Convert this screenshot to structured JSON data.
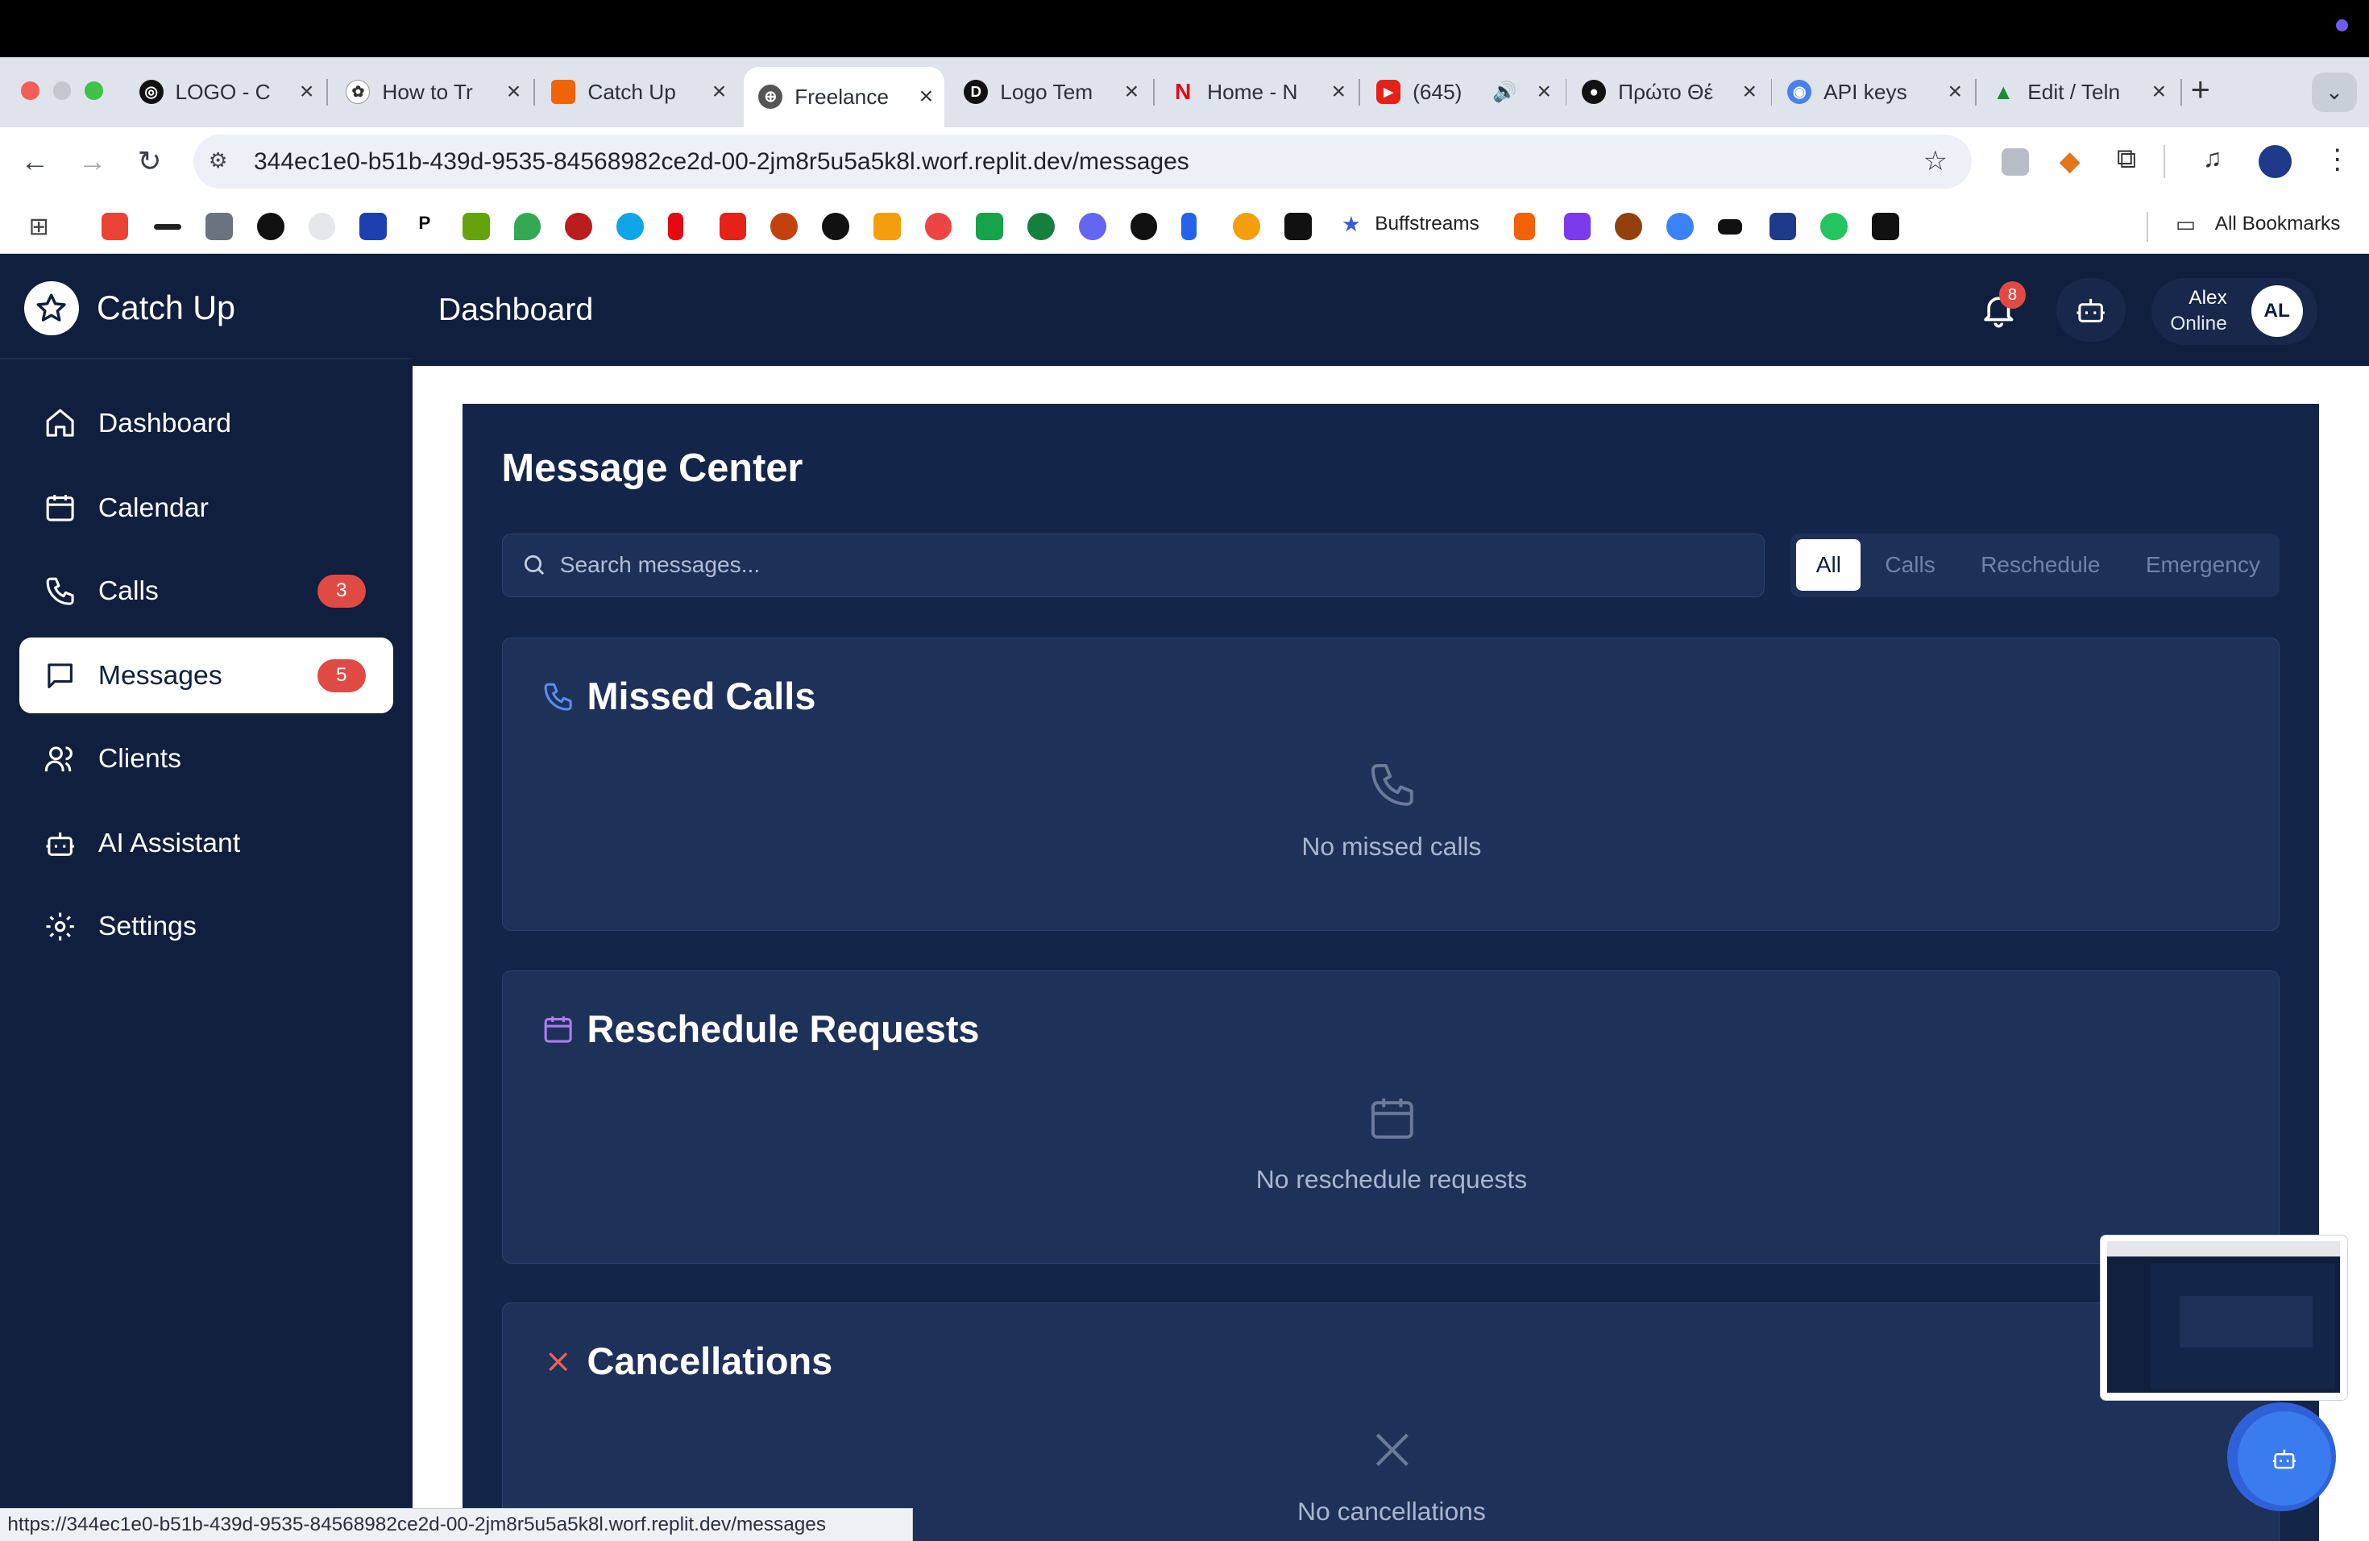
{
  "browser": {
    "tabs": [
      {
        "title": "LOGO - C",
        "icon": "openai-icon"
      },
      {
        "title": "How to Tr",
        "icon": "brain-icon"
      },
      {
        "title": "Catch Up",
        "icon": "replit-icon"
      },
      {
        "title": "Freelance",
        "icon": "globe-icon"
      },
      {
        "title": "Logo Tem",
        "icon": "d-icon"
      },
      {
        "title": "Home - N",
        "icon": "netflix-icon"
      },
      {
        "title": "(645)",
        "icon": "youtube-icon"
      },
      {
        "title": "Πρώτο Θέ",
        "icon": "person-icon"
      },
      {
        "title": "API keys",
        "icon": "api-icon"
      },
      {
        "title": "Edit / Teln",
        "icon": "triangle-icon"
      }
    ],
    "url": "344ec1e0-b51b-439d-9535-84568982ce2d-00-2jm8r5u5a5k8l.worf.replit.dev/messages",
    "bookmarks_label": "Buffstreams",
    "all_bookmarks": "All Bookmarks",
    "status_url": "https://344ec1e0-b51b-439d-9535-84568982ce2d-00-2jm8r5u5a5k8l.worf.replit.dev/messages"
  },
  "app": {
    "brand": "Catch Up",
    "sidebar": [
      {
        "label": "Dashboard",
        "icon": "home-icon"
      },
      {
        "label": "Calendar",
        "icon": "calendar-icon"
      },
      {
        "label": "Calls",
        "icon": "phone-icon",
        "badge": "3"
      },
      {
        "label": "Messages",
        "icon": "message-icon",
        "badge": "5",
        "active": true
      },
      {
        "label": "Clients",
        "icon": "users-icon"
      },
      {
        "label": "AI Assistant",
        "icon": "bot-icon"
      },
      {
        "label": "Settings",
        "icon": "gear-icon"
      }
    ],
    "header": {
      "title": "Dashboard",
      "notifications": "8",
      "user_name": "Alex",
      "user_status": "Online",
      "avatar": "AL"
    },
    "messages": {
      "title": "Message Center",
      "search_placeholder": "Search messages...",
      "filters": [
        "All",
        "Calls",
        "Reschedule",
        "Emergency"
      ],
      "active_filter": "All",
      "sections": [
        {
          "title": "Missed Calls",
          "empty": "No missed calls",
          "icon": "phone-icon",
          "color": "#5b8def"
        },
        {
          "title": "Reschedule Requests",
          "empty": "No reschedule requests",
          "icon": "calendar-icon",
          "color": "#b07cf0"
        },
        {
          "title": "Cancellations",
          "empty": "No cancellations",
          "icon": "x-icon",
          "color": "#e8625b"
        }
      ]
    }
  },
  "colors": {
    "sidebar": "#0f1f3d",
    "panel": "#14254a",
    "card": "#1d3159",
    "badge": "#e04a45",
    "fab": "#3a7bf0"
  }
}
